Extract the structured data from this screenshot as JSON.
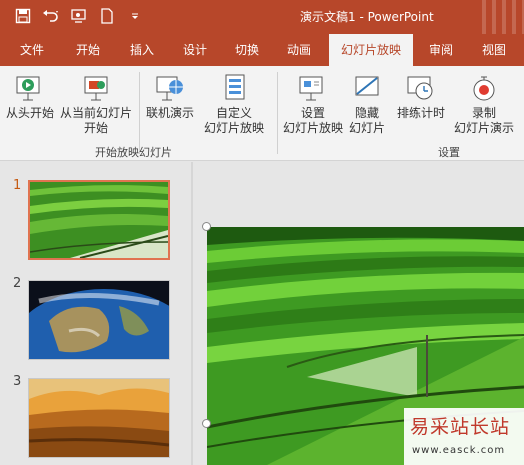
{
  "window": {
    "title": "演示文稿1 - PowerPoint"
  },
  "qat": {
    "icons": [
      "save-icon",
      "undo-icon",
      "redo-icon",
      "new-file-icon",
      "customize-icon"
    ]
  },
  "tabs": [
    "文件",
    "开始",
    "插入",
    "设计",
    "切换",
    "动画",
    "幻灯片放映",
    "审阅",
    "视图"
  ],
  "active_tab": "幻灯片放映",
  "ribbon": {
    "from_start": {
      "line1": "从头开始",
      "line2": ""
    },
    "from_current": {
      "line1": "从当前幻灯片",
      "line2": "开始"
    },
    "present_online": {
      "line1": "联机演示",
      "line2": ""
    },
    "custom_show": {
      "line1": "自定义",
      "line2": "幻灯片放映"
    },
    "group_start_label": "开始放映幻灯片",
    "setup_show": {
      "line1": "设置",
      "line2": "幻灯片放映"
    },
    "hide_slide": {
      "line1": "隐藏",
      "line2": "幻灯片"
    },
    "rehearse": {
      "line1": "排练计时",
      "line2": ""
    },
    "record": {
      "line1": "录制",
      "line2": "幻灯片演示"
    },
    "group_setup_label": "设置"
  },
  "slides": [
    {
      "number": "1",
      "content": "green-terraces-photo"
    },
    {
      "number": "2",
      "content": "earth-from-space-photo"
    },
    {
      "number": "3",
      "content": "desert-dunes-photo"
    }
  ],
  "watermark": {
    "line1": "易采站长站",
    "line2": "www.easck.com"
  },
  "colors": {
    "accent": "#b7472a",
    "selection": "#e07350",
    "ribbon_bg": "#f3f3f3"
  }
}
